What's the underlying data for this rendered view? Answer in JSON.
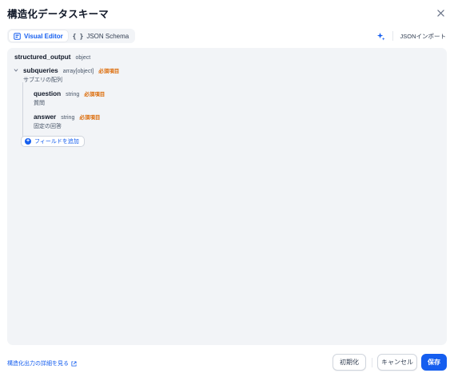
{
  "dialog": {
    "title": "構造化データスキーマ",
    "close_icon": "close-icon"
  },
  "tabs": [
    {
      "label": "Visual Editor",
      "icon": "visual-editor-icon",
      "active": true
    },
    {
      "label": "JSON Schema",
      "icon": "braces-icon",
      "active": false
    }
  ],
  "toolbar": {
    "ai_icon": "sparkle-icon",
    "import_label": "JSONインポート"
  },
  "schema": {
    "root": {
      "name": "structured_output",
      "type": "object"
    },
    "fields": [
      {
        "name": "subqueries",
        "type": "array[object]",
        "required": "必須項目",
        "description": "サブエリの配列",
        "children": [
          {
            "name": "question",
            "type": "string",
            "required": "必須項目",
            "description": "質問"
          },
          {
            "name": "answer",
            "type": "string",
            "required": "必須項目",
            "description": "固定の回答"
          }
        ]
      }
    ],
    "add_field_label": "フィールドを追加"
  },
  "footer": {
    "doc_link": "構造化出力の詳細を見る",
    "reset_label": "初期化",
    "cancel_label": "キャンセル",
    "save_label": "保存"
  },
  "colors": {
    "accent": "#155eef",
    "required": "#dc6803",
    "editor_bg": "#f2f4f7"
  }
}
